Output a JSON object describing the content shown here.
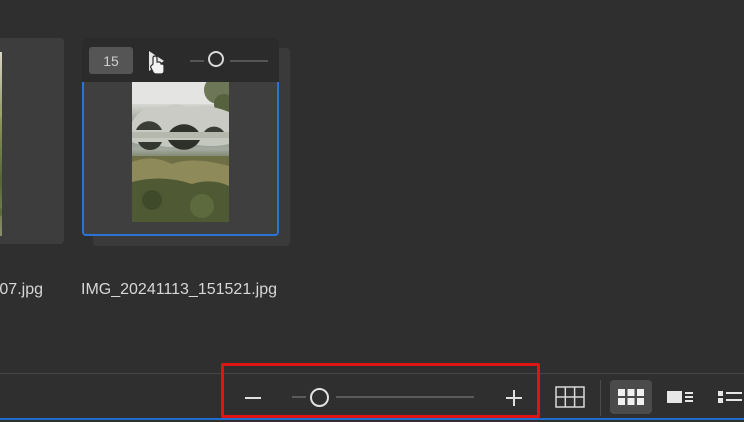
{
  "thumbnails": [
    {
      "filename": "07.jpg",
      "selected": false
    },
    {
      "filename": "IMG_20241113_151521.jpg",
      "selected": true
    }
  ],
  "hover_controls": {
    "frame_count": "15",
    "play_icon": "play-icon",
    "slider_icon": "playback-slider"
  },
  "bottom_bar": {
    "zoom_out_icon": "minus-icon",
    "zoom_in_icon": "plus-icon",
    "zoom_level_fraction": 0.12,
    "views": [
      {
        "icon": "grid-large-icon",
        "active": false
      },
      {
        "icon": "grid-small-icon",
        "active": true
      },
      {
        "icon": "filmstrip-icon",
        "active": false
      },
      {
        "icon": "list-icon",
        "active": false
      }
    ]
  },
  "colors": {
    "background": "#2f2f2f",
    "selection_border": "#2b74d6",
    "highlight_box": "#e01414"
  }
}
